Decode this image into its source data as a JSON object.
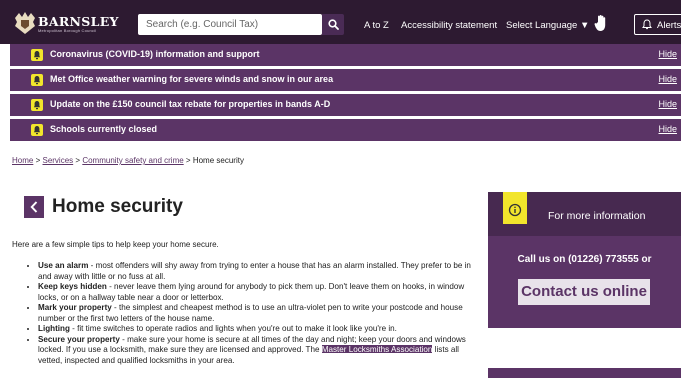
{
  "header": {
    "logo_name": "BARNSLEY",
    "logo_sub": "Metropolitan Borough Council",
    "search_placeholder": "Search (e.g. Council Tax)",
    "nav": [
      "A to Z",
      "Accessibility statement",
      "Select Language ▼"
    ],
    "alerts_label": "Alerts"
  },
  "alerts": [
    {
      "text": "Coronavirus (COVID-19) information and support",
      "hide": "Hide"
    },
    {
      "text": "Met Office weather warning for severe winds and snow in our area",
      "hide": "Hide"
    },
    {
      "text": "Update on the £150 council tax rebate for properties in bands A-D",
      "hide": "Hide"
    },
    {
      "text": "Schools currently closed",
      "hide": "Hide"
    }
  ],
  "breadcrumb": {
    "items": [
      "Home",
      "Services",
      "Community safety and crime"
    ],
    "separator": ">",
    "current": "Home security"
  },
  "page": {
    "title": "Home security",
    "intro": "Here are a few simple tips to help keep your home secure.",
    "tips": [
      {
        "title": "Use an alarm",
        "text": " - most offenders will shy away from trying to enter a house that has an alarm installed. They prefer to be in and away with little or no fuss at all."
      },
      {
        "title": "Keep keys hidden",
        "text": " - never leave them lying around for anybody to pick them up. Don't leave them on hooks, in window locks, or on a hallway table near a door or letterbox."
      },
      {
        "title": "Mark your property",
        "text": " - the simplest and cheapest method is to use an ultra-violet pen to write your postcode and house number or the first two letters of the house name."
      },
      {
        "title": "Lighting",
        "text": " - fit time switches to operate radios and lights when you're out to make it look like you're in."
      },
      {
        "title": "Secure your property",
        "text": " - make sure your home is secure at all times of the day and night; keep your doors and windows locked. If you use a locksmith, make sure they are licensed and approved. The ",
        "link": "Master Locksmiths Association",
        "after": " lists all vetted, inspected and qualified locksmiths in your area."
      }
    ]
  },
  "sidebar": {
    "title": "For more information",
    "call": "Call us on (01226) 773555 or",
    "contact": "Contact us online"
  },
  "colors": {
    "header_bg": "#2d1a31",
    "alert_bg": "#5b3466",
    "alert_icon": "#f2e52c",
    "brand_purple": "#5b3466"
  }
}
